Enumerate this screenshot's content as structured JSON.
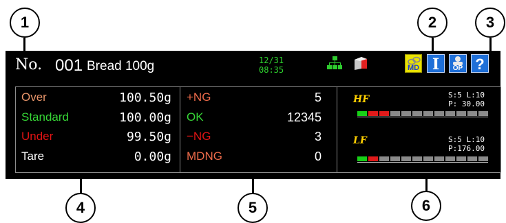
{
  "callouts": [
    "1",
    "2",
    "3",
    "4",
    "5",
    "6"
  ],
  "header": {
    "no_label": "No.",
    "number": "001",
    "product": "Bread 100g",
    "date": "12/31",
    "time": "08:35"
  },
  "icons": {
    "network": "network-icon",
    "storage": "storage-icon",
    "md": "md-icon",
    "info": "info-icon",
    "op": "operator-icon",
    "help": "help-icon"
  },
  "icon_text": {
    "md": "MD",
    "info": "I",
    "op": "OP",
    "help": "?"
  },
  "weights": [
    {
      "label": "Over",
      "value": "100.50g",
      "color": "#e8956a"
    },
    {
      "label": "Standard",
      "value": "100.00g",
      "color": "#36d636"
    },
    {
      "label": "Under",
      "value": "99.50g",
      "color": "#e01414"
    },
    {
      "label": "Tare",
      "value": "0.00g",
      "color": "#ffffff"
    }
  ],
  "counts": [
    {
      "label": "+NG",
      "value": "5",
      "color": "#ee6b4a"
    },
    {
      "label": "OK",
      "value": "12345",
      "color": "#36d636"
    },
    {
      "label": "−NG",
      "value": "3",
      "color": "#e01414"
    },
    {
      "label": "MDNG",
      "value": "0",
      "color": "#ee6b4a"
    }
  ],
  "filters": [
    {
      "name": "HF",
      "sl": "S:5 L:10",
      "p": "P: 30.00",
      "segments": [
        "green",
        "red",
        "red",
        "gray",
        "gray",
        "gray",
        "gray",
        "gray",
        "gray",
        "gray",
        "gray",
        "gray"
      ]
    },
    {
      "name": "LF",
      "sl": "S:5 L:10",
      "p": "P:176.00",
      "segments": [
        "green",
        "red",
        "gray",
        "gray",
        "gray",
        "gray",
        "gray",
        "gray",
        "gray",
        "gray",
        "gray",
        "gray"
      ]
    }
  ],
  "colors": {
    "green": "#17d017",
    "red": "#e01a1a",
    "gray": "#8a8a8a"
  }
}
